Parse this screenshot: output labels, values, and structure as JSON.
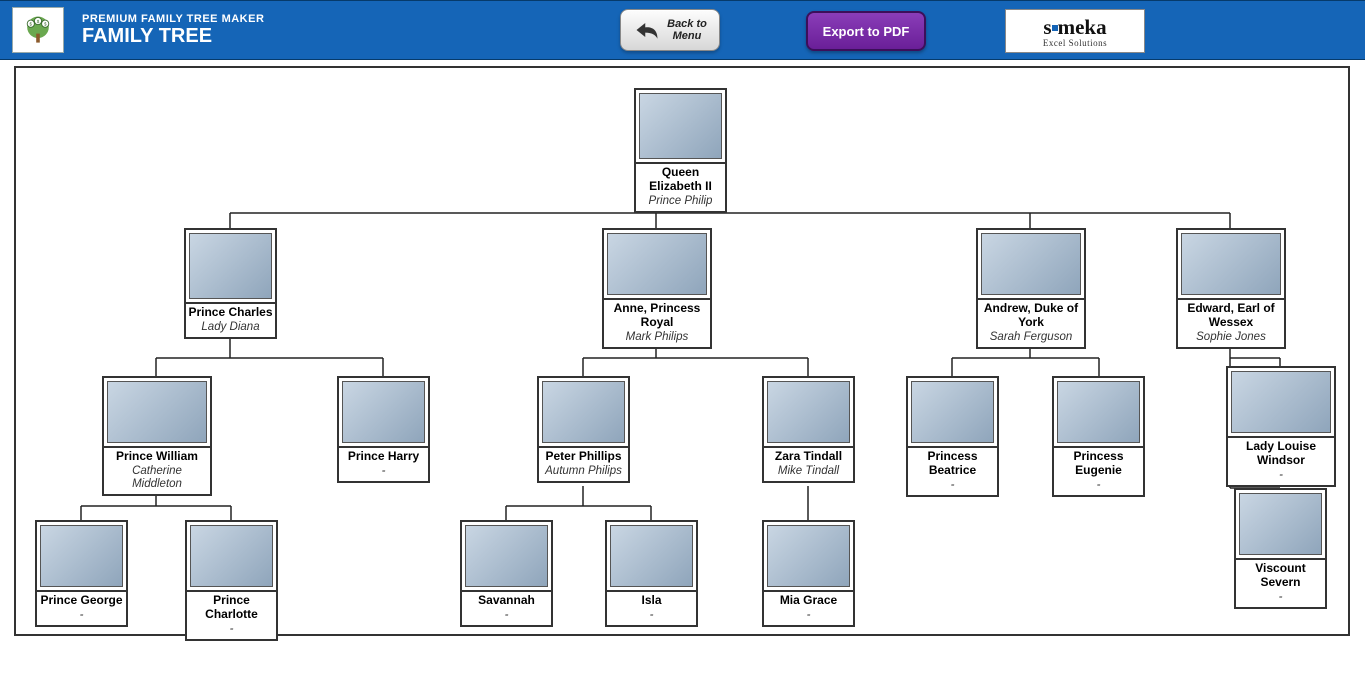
{
  "header": {
    "subtitle": "PREMIUM FAMILY TREE MAKER",
    "title": "FAMILY TREE",
    "back_line1": "Back to",
    "back_line2": "Menu",
    "export_label": "Export to PDF",
    "brand_name": "someka",
    "brand_sub": "Excel Solutions"
  },
  "tree": {
    "root": {
      "name": "Queen Elizabeth II",
      "spouse": "Prince Philip"
    },
    "gen1": [
      {
        "name": "Prince Charles",
        "spouse": "Lady Diana"
      },
      {
        "name": "Anne, Princess Royal",
        "spouse": "Mark Philips"
      },
      {
        "name": "Andrew, Duke of York",
        "spouse": "Sarah Ferguson"
      },
      {
        "name": "Edward, Earl of Wessex",
        "spouse": "Sophie Jones"
      }
    ],
    "gen2": [
      {
        "name": "Prince William",
        "spouse": "Catherine Middleton"
      },
      {
        "name": "Prince Harry",
        "spouse": "-"
      },
      {
        "name": "Peter Phillips",
        "spouse": "Autumn Philips"
      },
      {
        "name": "Zara Tindall",
        "spouse": "Mike Tindall"
      },
      {
        "name": "Princess Beatrice",
        "spouse": "-"
      },
      {
        "name": "Princess Eugenie",
        "spouse": "-"
      },
      {
        "name": "Lady Louise Windsor",
        "spouse": "-"
      },
      {
        "name": "Viscount Severn",
        "spouse": "-"
      }
    ],
    "gen3": [
      {
        "name": "Prince George",
        "spouse": "-"
      },
      {
        "name": "Prince Charlotte",
        "spouse": "-"
      },
      {
        "name": "Savannah",
        "spouse": "-"
      },
      {
        "name": "Isla",
        "spouse": "-"
      },
      {
        "name": "Mia Grace",
        "spouse": "-"
      }
    ]
  }
}
